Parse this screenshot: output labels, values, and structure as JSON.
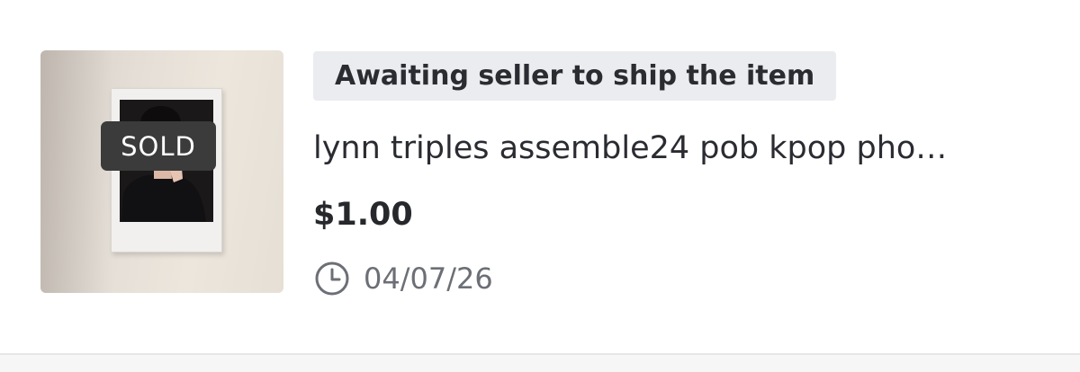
{
  "listing": {
    "badge": "SOLD",
    "status": "Awaiting seller to ship the item",
    "title": "lynn triples assemble24 pob kpop pho…",
    "price": "$1.00",
    "date": "04/07/26",
    "date_icon": "clock-icon"
  }
}
